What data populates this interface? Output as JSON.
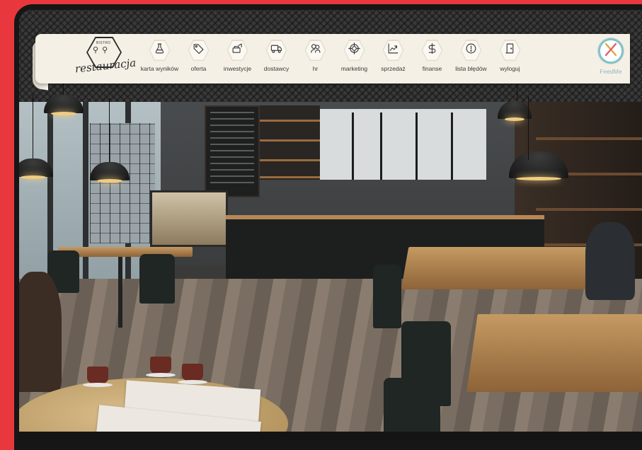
{
  "brand": {
    "logo_top_text": "BISTRO",
    "logo_script": "restauracja"
  },
  "nav": {
    "items": [
      {
        "label": "karta wyników",
        "icon": "flask-icon"
      },
      {
        "label": "oferta",
        "icon": "tag-icon"
      },
      {
        "label": "inwestycje",
        "icon": "investment-icon"
      },
      {
        "label": "dostawcy",
        "icon": "truck-icon"
      },
      {
        "label": "hr",
        "icon": "people-icon"
      },
      {
        "label": "marketing",
        "icon": "target-icon"
      },
      {
        "label": "sprzedaż",
        "icon": "sales-chart-icon"
      },
      {
        "label": "finanse",
        "icon": "dollar-icon"
      },
      {
        "label": "lista błędów",
        "icon": "warning-icon"
      },
      {
        "label": "wyloguj",
        "icon": "logout-door-icon"
      }
    ],
    "feedme_label": "FeedMe",
    "feedme_icon": "fork-knife-icon"
  },
  "colors": {
    "background_red": "#e8383d",
    "nav_paper": "#f5f0e6",
    "feedme_accent": "#7fc4cf"
  }
}
